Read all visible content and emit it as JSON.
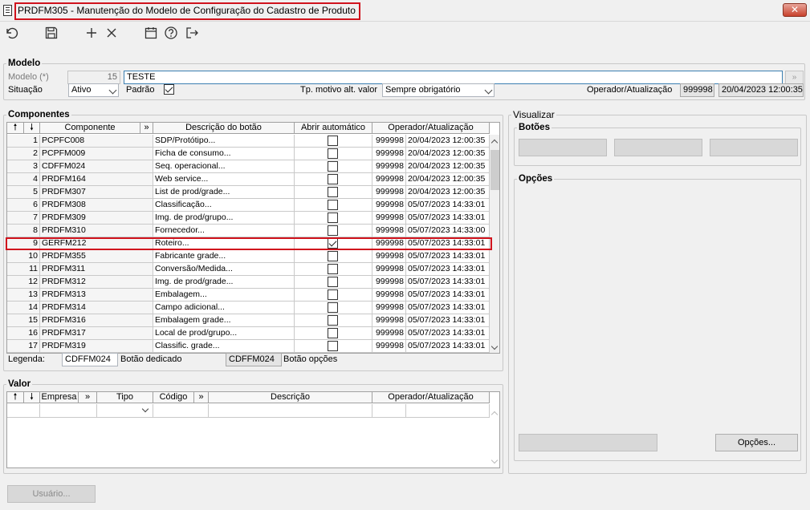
{
  "window": {
    "title": "PRDFM305 - Manutenção do Modelo de Configuração do Cadastro de Produto",
    "close": "✕"
  },
  "toolbar": {
    "icons": [
      "undo-icon",
      "save-icon",
      "add-icon",
      "delete-icon",
      "calendar-icon",
      "help-icon",
      "exit-icon"
    ]
  },
  "modelo": {
    "section": "Modelo",
    "modelo_label": "Modelo (*)",
    "modelo_num": "15",
    "modelo_nome": "TESTE",
    "situacao_label": "Situação",
    "situacao_value": "Ativo",
    "padrao_label": "Padrão",
    "padrao_checked": true,
    "tp_motivo_label": "Tp. motivo alt. valor",
    "tp_motivo_value": "Sempre obrigatório",
    "operador_label": "Operador/Atualização",
    "operador_value": "999998",
    "atualizacao_value": "20/04/2023 12:00:35"
  },
  "componentes": {
    "section": "Componentes",
    "headers": {
      "up": "🠕",
      "down": "🠗",
      "componente": "Componente",
      "more": "»",
      "descricao": "Descrição do botão",
      "abrir": "Abrir automático",
      "operador": "Operador/Atualização"
    },
    "rows": [
      {
        "n": "1",
        "comp": "PCPFC008",
        "desc": "SDP/Protótipo...",
        "chk": false,
        "op": "999998",
        "dt": "20/04/2023 12:00:35"
      },
      {
        "n": "2",
        "comp": "PCPFM009",
        "desc": "Ficha de consumo...",
        "chk": false,
        "op": "999998",
        "dt": "20/04/2023 12:00:35"
      },
      {
        "n": "3",
        "comp": "CDFFM024",
        "desc": "Seq. operacional...",
        "chk": false,
        "op": "999998",
        "dt": "20/04/2023 12:00:35"
      },
      {
        "n": "4",
        "comp": "PRDFM164",
        "desc": "Web service...",
        "chk": false,
        "op": "999998",
        "dt": "20/04/2023 12:00:35"
      },
      {
        "n": "5",
        "comp": "PRDFM307",
        "desc": "List de prod/grade...",
        "chk": false,
        "op": "999998",
        "dt": "20/04/2023 12:00:35"
      },
      {
        "n": "6",
        "comp": "PRDFM308",
        "desc": "Classificação...",
        "chk": false,
        "op": "999998",
        "dt": "05/07/2023 14:33:01"
      },
      {
        "n": "7",
        "comp": "PRDFM309",
        "desc": "Img. de prod/grupo...",
        "chk": false,
        "op": "999998",
        "dt": "05/07/2023 14:33:01"
      },
      {
        "n": "8",
        "comp": "PRDFM310",
        "desc": "Fornecedor...",
        "chk": false,
        "op": "999998",
        "dt": "05/07/2023 14:33:00"
      },
      {
        "n": "9",
        "comp": "GERFM212",
        "desc": "Roteiro...",
        "chk": true,
        "op": "999998",
        "dt": "05/07/2023 14:33:01"
      },
      {
        "n": "10",
        "comp": "PRDFM355",
        "desc": "Fabricante grade...",
        "chk": false,
        "op": "999998",
        "dt": "05/07/2023 14:33:01"
      },
      {
        "n": "11",
        "comp": "PRDFM311",
        "desc": "Conversão/Medida...",
        "chk": false,
        "op": "999998",
        "dt": "05/07/2023 14:33:01"
      },
      {
        "n": "12",
        "comp": "PRDFM312",
        "desc": "Img. de prod/grade...",
        "chk": false,
        "op": "999998",
        "dt": "05/07/2023 14:33:01"
      },
      {
        "n": "13",
        "comp": "PRDFM313",
        "desc": "Embalagem...",
        "chk": false,
        "op": "999998",
        "dt": "05/07/2023 14:33:01"
      },
      {
        "n": "14",
        "comp": "PRDFM314",
        "desc": "Campo adicional...",
        "chk": false,
        "op": "999998",
        "dt": "05/07/2023 14:33:01"
      },
      {
        "n": "15",
        "comp": "PRDFM316",
        "desc": "Embalagem grade...",
        "chk": false,
        "op": "999998",
        "dt": "05/07/2023 14:33:01"
      },
      {
        "n": "16",
        "comp": "PRDFM317",
        "desc": "Local de prod/grupo...",
        "chk": false,
        "op": "999998",
        "dt": "05/07/2023 14:33:01"
      },
      {
        "n": "17",
        "comp": "PRDFM319",
        "desc": "Classific. grade...",
        "chk": false,
        "op": "999998",
        "dt": "05/07/2023 14:33:01"
      }
    ],
    "highlighted_row": "9",
    "legenda_label": "Legenda:",
    "legenda1_value": "CDFFM024",
    "legenda1_label": "Botão dedicado",
    "legenda2_value": "CDFFM024",
    "legenda2_label": "Botão opções"
  },
  "valor": {
    "section": "Valor",
    "headers": {
      "up": "🠕",
      "down": "🠗",
      "empresa": "Empresa",
      "more1": "»",
      "tipo": "Tipo",
      "codigo": "Código",
      "more2": "»",
      "descricao": "Descrição",
      "operador": "Operador/Atualização"
    }
  },
  "visualizar": {
    "section": "Visualizar",
    "botoes": "Botões",
    "opcoes": "Opções",
    "opcoes_button": "Opções..."
  },
  "footer": {
    "usuario_button": "Usuário..."
  },
  "colors": {
    "highlight": "#d0131d",
    "input_border_active": "#3c7fb1"
  }
}
